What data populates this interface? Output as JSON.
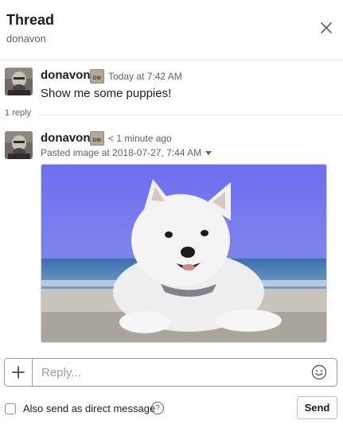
{
  "header": {
    "title": "Thread",
    "subtitle": "donavon",
    "close_icon": "close-icon"
  },
  "messages": [
    {
      "author": "donavon",
      "badge": "DW",
      "time": "Today at 7:42 AM",
      "text": "Show me some puppies!"
    },
    {
      "author": "donavon",
      "badge": "DW",
      "time": "< 1 minute ago",
      "attachment_meta": "Pasted image at 2018-07-27, 7:44 AM",
      "attachment_icon": "image-thumbnail"
    }
  ],
  "reply_count": "1 reply",
  "composer": {
    "placeholder": "Reply...",
    "value": "",
    "plus_icon": "plus-icon",
    "emoji_icon": "smiley-icon"
  },
  "footer": {
    "checkbox_label": "Also send as direct message",
    "help_icon_glyph": "?",
    "send_label": "Send"
  },
  "colors": {
    "text": "#1d1c1d",
    "muted": "#616061",
    "border": "#9a9a9a"
  }
}
